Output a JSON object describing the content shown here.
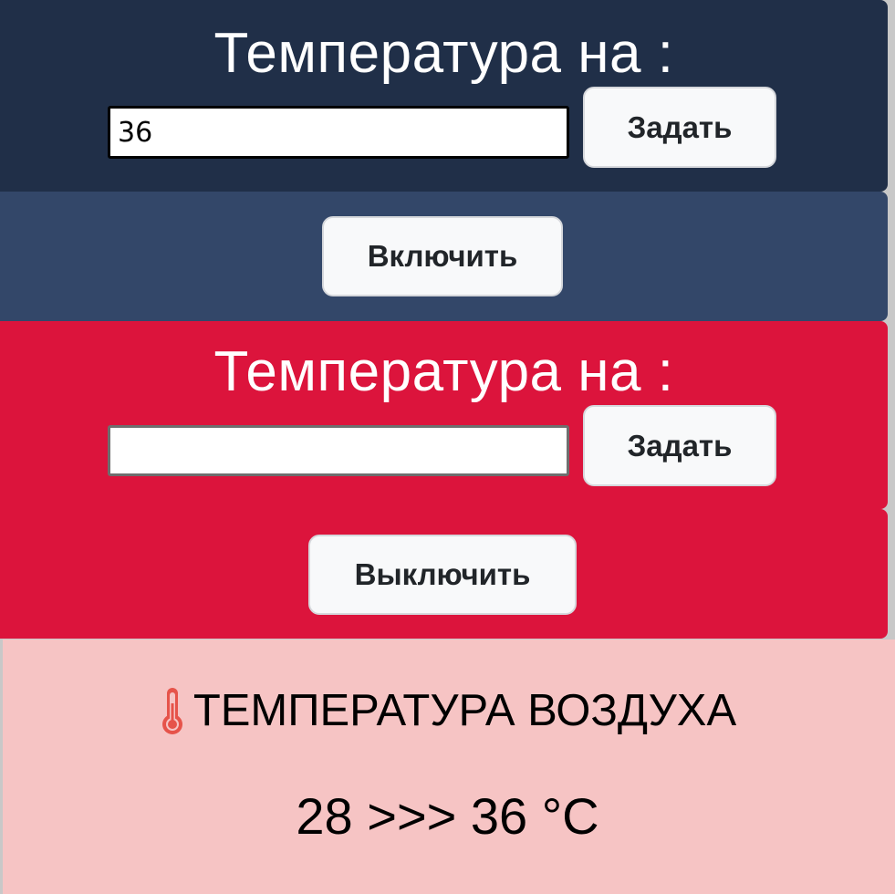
{
  "colors": {
    "panel_top": "#202f48",
    "panel_on": "#334769",
    "panel_red": "#dc143c",
    "sensor_bg": "#f6c4c4",
    "button_bg": "#f8f9fa"
  },
  "set_panel_1": {
    "title": "Температура на :",
    "input_value": "36",
    "button_label": "Задать"
  },
  "on_panel": {
    "button_label": "Включить"
  },
  "set_panel_2": {
    "title": "Температура на :",
    "input_value": "",
    "button_label": "Задать"
  },
  "off_panel": {
    "button_label": "Выключить"
  },
  "sensor": {
    "icon": "thermometer-icon",
    "heading": "ТЕМПЕРАТУРА ВОЗДУХА",
    "reading": "28 >>> 36 °C"
  }
}
